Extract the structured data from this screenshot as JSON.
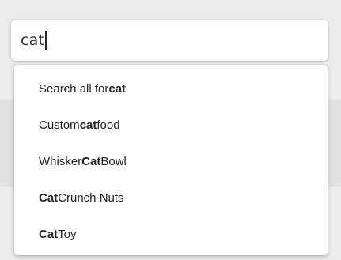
{
  "search": {
    "value": "cat"
  },
  "suggestions": [
    {
      "parts": [
        "Search all for ",
        "cat",
        ""
      ]
    },
    {
      "parts": [
        "Custom ",
        "cat",
        " food"
      ]
    },
    {
      "parts": [
        "Whisker ",
        "Cat",
        " Bowl"
      ]
    },
    {
      "parts": [
        "",
        "Cat",
        " Crunch Nuts"
      ]
    },
    {
      "parts": [
        "",
        "Cat",
        " Toy"
      ]
    }
  ]
}
